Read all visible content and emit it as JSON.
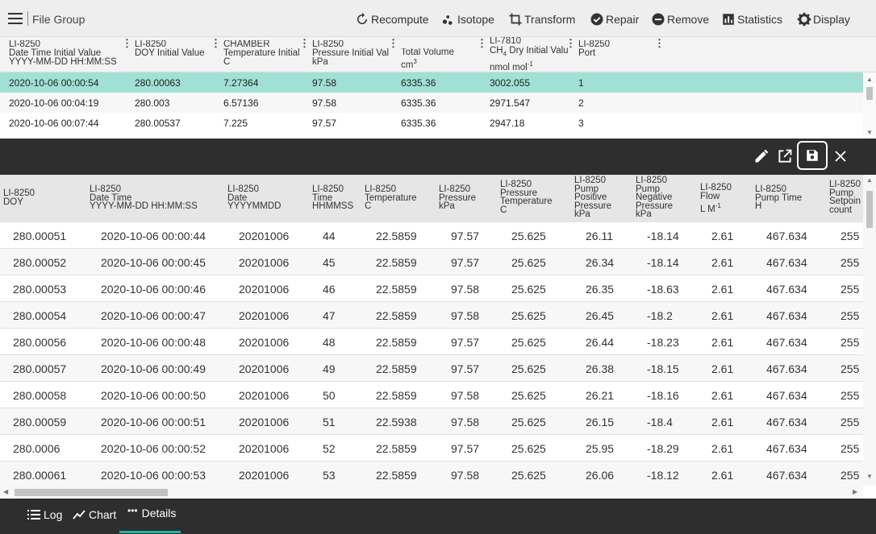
{
  "toolbar": {
    "group_label": "File Group",
    "buttons": [
      {
        "label": "Recompute",
        "icon": "recompute-icon"
      },
      {
        "label": "Isotope",
        "icon": "isotope-icon"
      },
      {
        "label": "Transform",
        "icon": "crop-icon"
      },
      {
        "label": "Repair",
        "icon": "check-circle-icon"
      },
      {
        "label": "Remove",
        "icon": "minus-circle-icon"
      },
      {
        "label": "Statistics",
        "icon": "bar-chart-icon"
      },
      {
        "label": "Display",
        "icon": "gear-icon"
      }
    ]
  },
  "upper_table": {
    "columns": [
      [
        "LI-8250",
        "Date Time Initial Value",
        "YYYY-MM-DD HH:MM:SS"
      ],
      [
        "LI-8250",
        "DOY Initial Value",
        ""
      ],
      [
        "CHAMBER",
        "Temperature Initial",
        "C"
      ],
      [
        "LI-8250",
        "Pressure Initial Val",
        "kPa"
      ],
      [
        "",
        "Total Volume",
        "cm"
      ],
      [
        "LI-7810",
        "CH",
        "nmol mol"
      ],
      [
        "LI-8250",
        "Port",
        ""
      ]
    ],
    "unit_sup": {
      "volume": "3",
      "ch4_sub": "4",
      "ch4_rest": " Dry Initial Valu",
      "nmol_sup": "-1"
    },
    "rows": [
      [
        "2020-10-06 00:00:54",
        "280.00063",
        "7.27364",
        "97.58",
        "6335.36",
        "3002.055",
        "1"
      ],
      [
        "2020-10-06 00:04:19",
        "280.003",
        "6.57136",
        "97.58",
        "6335.36",
        "2971.547",
        "2"
      ],
      [
        "2020-10-06 00:07:44",
        "280.00537",
        "7.225",
        "97.57",
        "6335.36",
        "2947.18",
        "3"
      ]
    ]
  },
  "lower_table": {
    "headers": [
      [
        "LI-8250",
        "DOY"
      ],
      [
        "LI-8250",
        "Date Time",
        "YYYY-MM-DD HH:MM:SS"
      ],
      [
        "LI-8250",
        "Date",
        "YYYYMMDD"
      ],
      [
        "LI-8250",
        "Time",
        "HHMMSS"
      ],
      [
        "LI-8250",
        "Temperature",
        "C"
      ],
      [
        "LI-8250",
        "Pressure",
        "kPa"
      ],
      [
        "LI-8250",
        "Pressure",
        "Temperature",
        "C"
      ],
      [
        "LI-8250",
        "Pump",
        "Positive",
        "Pressure",
        "kPa"
      ],
      [
        "LI-8250",
        "Pump",
        "Negative",
        "Pressure",
        "kPa"
      ],
      [
        "LI-8250",
        "Flow",
        "L M"
      ],
      [
        "LI-8250",
        "Pump Time",
        "H"
      ],
      [
        "LI-8250",
        "Pump",
        "Setpoin",
        "count"
      ]
    ],
    "flow_sup": "-1",
    "rows": [
      [
        "280.00051",
        "2020-10-06 00:00:44",
        "20201006",
        "44",
        "22.5859",
        "97.57",
        "25.625",
        "26.11",
        "-18.14",
        "2.61",
        "467.634",
        "255"
      ],
      [
        "280.00052",
        "2020-10-06 00:00:45",
        "20201006",
        "45",
        "22.5859",
        "97.57",
        "25.625",
        "26.34",
        "-18.14",
        "2.61",
        "467.634",
        "255"
      ],
      [
        "280.00053",
        "2020-10-06 00:00:46",
        "20201006",
        "46",
        "22.5859",
        "97.58",
        "25.625",
        "26.35",
        "-18.63",
        "2.61",
        "467.634",
        "255"
      ],
      [
        "280.00054",
        "2020-10-06 00:00:47",
        "20201006",
        "47",
        "22.5859",
        "97.58",
        "25.625",
        "26.45",
        "-18.2",
        "2.61",
        "467.634",
        "255"
      ],
      [
        "280.00056",
        "2020-10-06 00:00:48",
        "20201006",
        "48",
        "22.5859",
        "97.57",
        "25.625",
        "26.44",
        "-18.23",
        "2.61",
        "467.634",
        "255"
      ],
      [
        "280.00057",
        "2020-10-06 00:00:49",
        "20201006",
        "49",
        "22.5859",
        "97.57",
        "25.625",
        "26.38",
        "-18.15",
        "2.61",
        "467.634",
        "255"
      ],
      [
        "280.00058",
        "2020-10-06 00:00:50",
        "20201006",
        "50",
        "22.5859",
        "97.58",
        "25.625",
        "26.21",
        "-18.16",
        "2.61",
        "467.634",
        "255"
      ],
      [
        "280.00059",
        "2020-10-06 00:00:51",
        "20201006",
        "51",
        "22.5938",
        "97.58",
        "25.625",
        "26.15",
        "-18.4",
        "2.61",
        "467.634",
        "255"
      ],
      [
        "280.0006",
        "2020-10-06 00:00:52",
        "20201006",
        "52",
        "22.5859",
        "97.57",
        "25.625",
        "25.95",
        "-18.29",
        "2.61",
        "467.634",
        "255"
      ],
      [
        "280.00061",
        "2020-10-06 00:00:53",
        "20201006",
        "53",
        "22.5859",
        "97.58",
        "25.625",
        "26.06",
        "-18.12",
        "2.61",
        "467.634",
        "255"
      ]
    ]
  },
  "panel_icons": [
    "edit-icon",
    "open-external-icon",
    "save-icon",
    "close-icon"
  ],
  "bottom_tabs": [
    {
      "label": "Log",
      "icon": "list-icon"
    },
    {
      "label": "Chart",
      "icon": "line-chart-icon"
    },
    {
      "label": "Details",
      "icon": "more-horizontal-icon",
      "active": true
    }
  ],
  "colors": {
    "selected_row": "#a0e0d5",
    "tab_accent": "#1bb5a5",
    "dark_bar": "#2e2e2e"
  }
}
